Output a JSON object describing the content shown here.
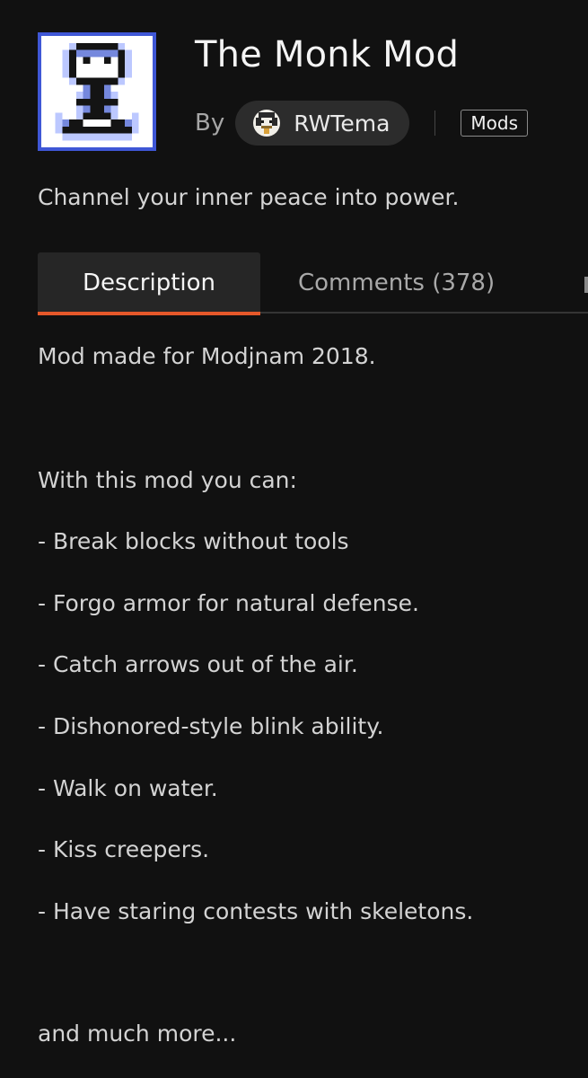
{
  "project": {
    "title": "The Monk Mod",
    "by_label": "By",
    "author": "RWTema",
    "category": "Mods",
    "summary": "Channel your inner peace into power."
  },
  "tabs": [
    {
      "label": "Description",
      "active": true
    },
    {
      "label": "Comments (378)",
      "active": false
    }
  ],
  "description": {
    "intro": "Mod made for Modjnam 2018.",
    "lead": "With this mod you can:",
    "features": [
      "- Break blocks without tools",
      "- Forgo armor for natural defense.",
      "- Catch arrows out of the air.",
      "- Dishonored-style blink ability.",
      "- Walk on water.",
      "- Kiss creepers.",
      "- Have staring contests with skeletons."
    ],
    "outro": "and much more..."
  },
  "colors": {
    "background": "#111111",
    "accent": "#e5582a",
    "icon_border": "#3f57d6",
    "chip": "#2c2c2c"
  },
  "icons": {
    "project": "monk-pixel-icon",
    "author_avatar": "author-avatar-icon"
  }
}
